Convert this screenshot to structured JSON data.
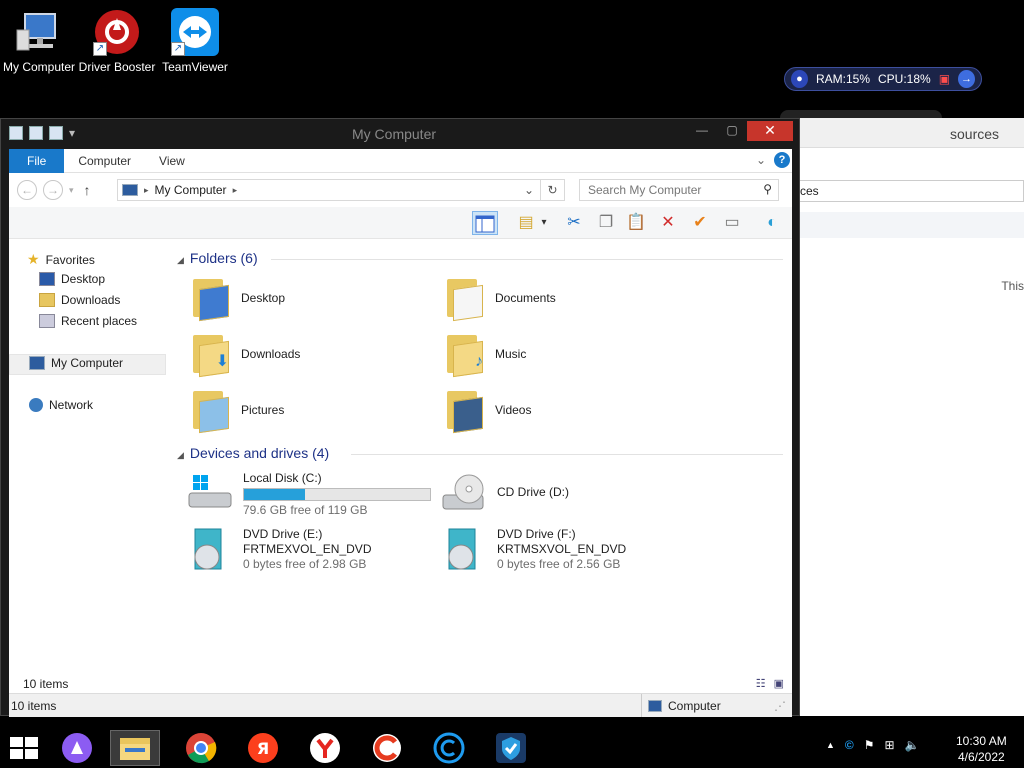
{
  "desktop": {
    "icons": [
      {
        "label": "My Computer"
      },
      {
        "label": "Driver Booster"
      },
      {
        "label": "TeamViewer"
      }
    ],
    "perf": {
      "ram": "RAM:15%",
      "cpu": "CPU:18%"
    }
  },
  "bg_window": {
    "title": "sources",
    "address": "rces",
    "text": "This"
  },
  "window": {
    "title": "My Computer",
    "ribbon": {
      "file": "File",
      "computer": "Computer",
      "view": "View",
      "help": "?"
    },
    "address": {
      "location": "My Computer"
    },
    "search": {
      "placeholder": "Search My Computer"
    },
    "nav": {
      "favorites": "Favorites",
      "desktop": "Desktop",
      "downloads": "Downloads",
      "recent": "Recent places",
      "computer": "My Computer",
      "network": "Network"
    },
    "folders_header": "Folders (6)",
    "folders": [
      {
        "name": "Desktop"
      },
      {
        "name": "Documents"
      },
      {
        "name": "Downloads"
      },
      {
        "name": "Music"
      },
      {
        "name": "Pictures"
      },
      {
        "name": "Videos"
      }
    ],
    "drives_header": "Devices and drives (4)",
    "drives": [
      {
        "name": "Local Disk (C:)",
        "free": "79.6 GB free of 119 GB",
        "used_fraction": 0.33
      },
      {
        "name": "CD Drive (D:)"
      },
      {
        "name": "DVD Drive (E:)",
        "label": "FRTMEXVOL_EN_DVD",
        "free": "0 bytes free of 2.98 GB"
      },
      {
        "name": "DVD Drive (F:)",
        "label": "KRTMSXVOL_EN_DVD",
        "free": "0 bytes free of 2.56 GB"
      }
    ],
    "status_items": "10 items",
    "status_bar_items": "10 items",
    "status_location": "Computer"
  },
  "taskbar": {
    "apps": [
      "alice",
      "file-explorer",
      "chrome",
      "yandex-browser",
      "yandex",
      "ccleaner",
      "ccleaner-cloud",
      "security-shield"
    ],
    "clock": {
      "time": "10:30 AM",
      "date": "4/6/2022"
    }
  },
  "colors": {
    "accent": "#1979ca",
    "close": "#c7352b",
    "progress": "#26a0da"
  }
}
